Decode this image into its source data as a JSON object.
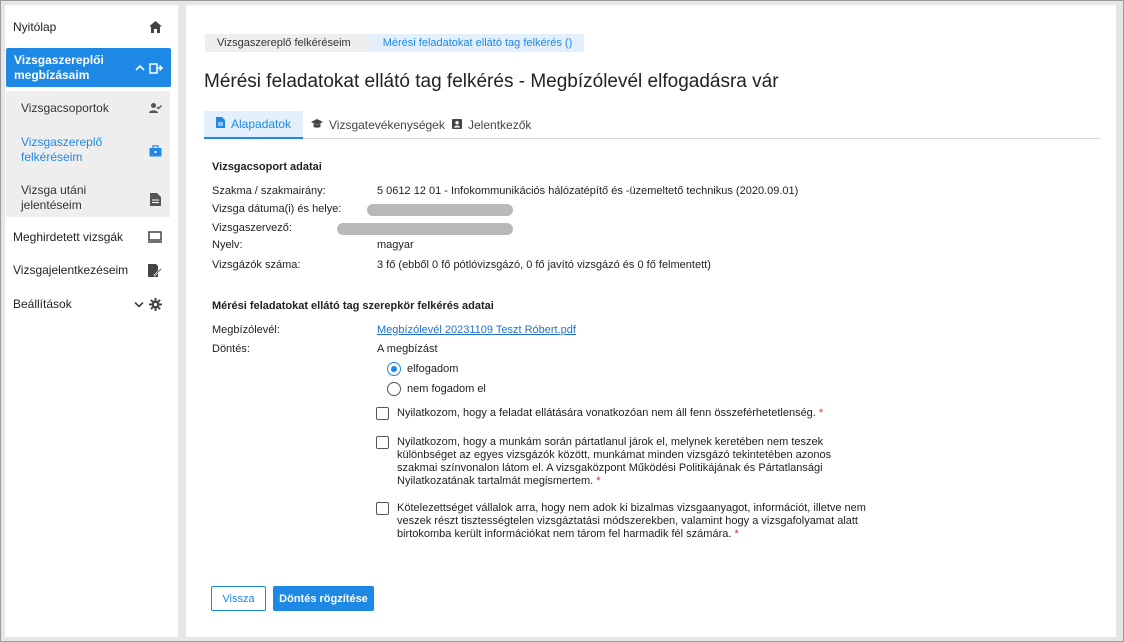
{
  "sidebar": {
    "items": [
      {
        "label": "Nyitólap",
        "icon": "home-icon"
      },
      {
        "label": "Vizsgaszereplői megbízásaim",
        "icon": "assignment-icon"
      },
      {
        "label": "Meghirdetett vizsgák",
        "icon": "monitor-icon"
      },
      {
        "label": "Vizsgajelentkezéseim",
        "icon": "edit-document-icon"
      },
      {
        "label": "Beállítások",
        "icon": "gear-icon"
      }
    ],
    "subitems": [
      {
        "label": "Vizsgacsoportok",
        "icon": "person-check-icon"
      },
      {
        "label": "Vizsgaszereplő felkéréseim",
        "icon": "briefcase-icon"
      },
      {
        "label": "Vizsga utáni jelentéseim",
        "icon": "document-icon"
      }
    ]
  },
  "breadcrumb": {
    "first": "Vizsgaszereplő felkéréseim",
    "second": "Mérési feladatokat ellátó tag felkérés ()"
  },
  "page": {
    "title": "Mérési feladatokat ellátó tag felkérés - Megbízólevél elfogadásra vár"
  },
  "tabs": [
    {
      "label": "Alapadatok",
      "icon": "document-icon"
    },
    {
      "label": "Vizsgatevékenységek",
      "icon": "graduation-cap-icon"
    },
    {
      "label": "Jelentkezők",
      "icon": "contact-card-icon"
    }
  ],
  "group": {
    "title": "Vizsgacsoport adatai",
    "rows": [
      {
        "label": "Szakma / szakmairány:",
        "value": "5 0612 12 01 - Infokommunikációs hálózatépítő és -üzemeltető technikus (2020.09.01)"
      },
      {
        "label": "Vizsga dátuma(i) és helye:",
        "value": ""
      },
      {
        "label": "Vizsgaszervező:",
        "value": ""
      },
      {
        "label": "Nyelv:",
        "value": "magyar"
      },
      {
        "label": "Vizsgázók száma:",
        "value": "3 fő (ebből 0 fő pótlóvizsgázó, 0 fő javító vizsgázó és 0 fő felmentett)"
      }
    ]
  },
  "request": {
    "title": "Mérési feladatokat ellátó tag szerepkör felkérés adatai",
    "letter_label": "Megbízólevél:",
    "letter_link": "Megbízólevél 20231109 Teszt Róbert.pdf",
    "decision_label": "Döntés:",
    "decision_intro": "A megbízást",
    "options": [
      "elfogadom",
      "nem fogadom el"
    ],
    "selected": "elfogadom",
    "statements": [
      "Nyilatkozom, hogy a feladat ellátására vonatkozóan nem áll fenn összeférhetetlenség.",
      "Nyilatkozom, hogy a munkám során pártatlanul járok el, melynek keretében nem teszek különbséget az egyes vizsgázók között, munkámat minden vizsgázó tekintetében azonos szakmai színvonalon látom el. A vizsgaközpont Működési Politikájának és Pártatlansági Nyilatkozatának tartalmát megismertem.",
      "Kötelezettséget vállalok arra, hogy nem adok ki bizalmas vizsgaanyagot, információt, illetve nem veszek részt tisztességtelen vizsgáztatási módszerekben, valamint hogy a vizsgafolyamat alatt birtokomba került információkat nem tárom fel harmadik fél számára."
    ],
    "required_mark": "*"
  },
  "actions": {
    "back": "Vissza",
    "submit": "Döntés rögzítése"
  },
  "colors": {
    "accent": "#1e88e5",
    "required": "#d32f2f"
  }
}
